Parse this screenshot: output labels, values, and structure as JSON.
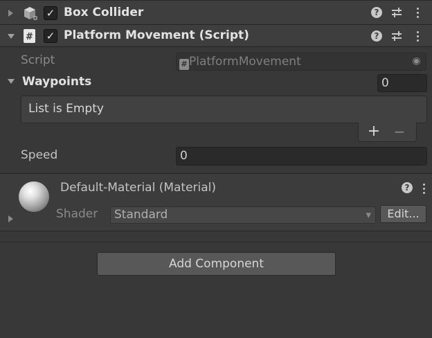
{
  "components": {
    "box_collider": {
      "title": "Box Collider",
      "enabled_mark": "✓"
    },
    "platform_movement": {
      "title": "Platform Movement (Script)",
      "enabled_mark": "✓",
      "script_icon": "#",
      "script_label": "Script",
      "script_value": "PlatformMovement",
      "waypoints_label": "Waypoints",
      "waypoints_count": "0",
      "list_empty_text": "List is Empty",
      "add_symbol": "+",
      "remove_symbol": "−",
      "speed_label": "Speed",
      "speed_value": "0"
    },
    "material": {
      "title": "Default-Material (Material)",
      "shader_label": "Shader",
      "shader_value": "Standard",
      "edit_label": "Edit..."
    }
  },
  "icons": {
    "help": "?",
    "settings": "⇅",
    "script_field_icon": "#",
    "target": "◉",
    "dropdown": "▾"
  },
  "footer": {
    "add_component_label": "Add Component"
  },
  "colors": {
    "background": "#383838",
    "header": "#3e3e3e",
    "field": "#2a2a2a"
  }
}
